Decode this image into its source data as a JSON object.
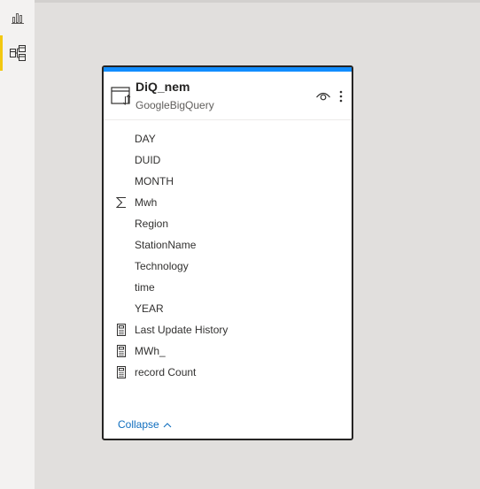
{
  "nav": {
    "items": [
      {
        "name": "report-view",
        "icon": "bar-chart-icon",
        "active": false
      },
      {
        "name": "model-view",
        "icon": "model-diagram-icon",
        "active": true
      }
    ]
  },
  "table_card": {
    "title": "DiQ_nem",
    "source": "GoogleBigQuery",
    "icon": "table-icon",
    "accent_color": "#118dff",
    "fields": [
      {
        "label": "DAY",
        "icon": "none"
      },
      {
        "label": "DUID",
        "icon": "none"
      },
      {
        "label": "MONTH",
        "icon": "none"
      },
      {
        "label": "Mwh",
        "icon": "sigma-icon"
      },
      {
        "label": "Region",
        "icon": "none"
      },
      {
        "label": "StationName",
        "icon": "none"
      },
      {
        "label": "Technology",
        "icon": "none"
      },
      {
        "label": "time",
        "icon": "none"
      },
      {
        "label": "YEAR",
        "icon": "none"
      },
      {
        "label": "Last Update History",
        "icon": "calculator-icon"
      },
      {
        "label": "MWh_",
        "icon": "calculator-icon"
      },
      {
        "label": "record Count",
        "icon": "calculator-icon"
      }
    ],
    "collapse_label": "Collapse"
  },
  "colors": {
    "canvas": "#e1dfdd",
    "nav_bg": "#f3f2f1",
    "active_indicator": "#f2c811",
    "link": "#106ebe"
  }
}
